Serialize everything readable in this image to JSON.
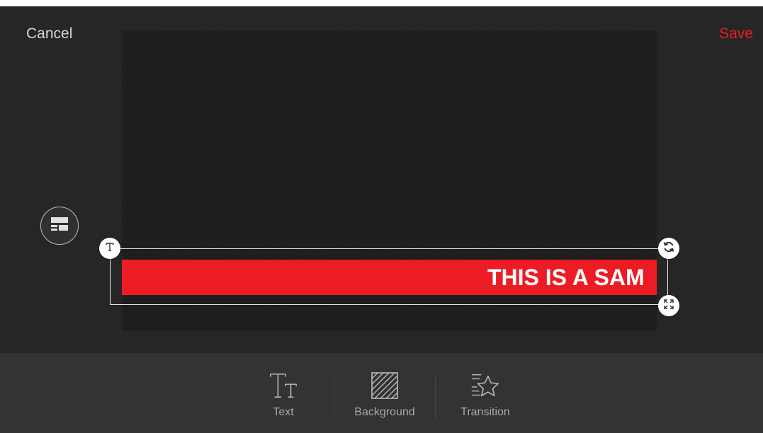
{
  "header": {
    "cancel_label": "Cancel",
    "save_label": "Save"
  },
  "canvas": {
    "banner_text": "THIS IS A SAM",
    "banner_color": "#ed1c24",
    "background_color": "#1c1c1c"
  },
  "selection_handles": {
    "text_handle_icon": "text-icon",
    "rotate_handle_icon": "rotate-icon",
    "resize_handle_icon": "expand-icon"
  },
  "side": {
    "layout_button_icon": "layout-icon"
  },
  "toolbar": {
    "items": [
      {
        "label": "Text",
        "icon": "text-style-icon"
      },
      {
        "label": "Background",
        "icon": "background-pattern-icon"
      },
      {
        "label": "Transition",
        "icon": "star-transition-icon"
      }
    ]
  },
  "colors": {
    "accent": "#ec1c24",
    "app_background": "#262626",
    "toolbar_background": "#333333",
    "label_gray": "#a8a8a8"
  }
}
